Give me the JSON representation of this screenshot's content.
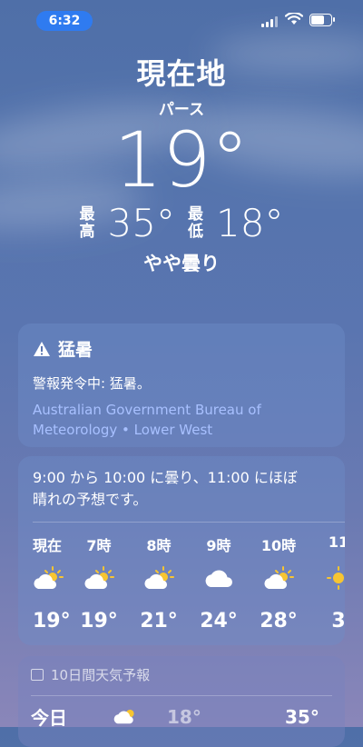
{
  "status": {
    "time": "6:32"
  },
  "location": {
    "title": "現在地",
    "city": "パース"
  },
  "current": {
    "temp": "19°",
    "high_label_1": "最",
    "high_label_2": "高",
    "high": "35°",
    "low_label_1": "最",
    "low_label_2": "低",
    "low": "18°",
    "condition": "やや曇り"
  },
  "alert": {
    "title": "猛暑",
    "text": "警報発令中: 猛暑。",
    "source_line1": "Australian Government Bureau of",
    "source_line2": "Meteorology • Lower West"
  },
  "hourly": {
    "desc_line1": "9:00 から 10:00 に曇り、11:00 にほぼ",
    "desc_line2": "晴れの予想です。",
    "hours": [
      {
        "time": "現在",
        "icon": "partly-cloudy-icon",
        "temp": "19°"
      },
      {
        "time": "7時",
        "icon": "partly-cloudy-icon",
        "temp": "19°"
      },
      {
        "time": "8時",
        "icon": "partly-cloudy-icon",
        "temp": "21°"
      },
      {
        "time": "9時",
        "icon": "cloud-icon",
        "temp": "24°"
      },
      {
        "time": "10時",
        "icon": "partly-cloudy-icon",
        "temp": "28°"
      },
      {
        "time": "11",
        "icon": "sun-icon",
        "temp": "3"
      }
    ]
  },
  "tenday": {
    "title": "10日間天気予報",
    "first_row": {
      "day": "今日",
      "low": "18°",
      "high": "35°"
    }
  },
  "colors": {
    "accent": "#2f7bf0",
    "source_link": "#a8c0ff"
  }
}
